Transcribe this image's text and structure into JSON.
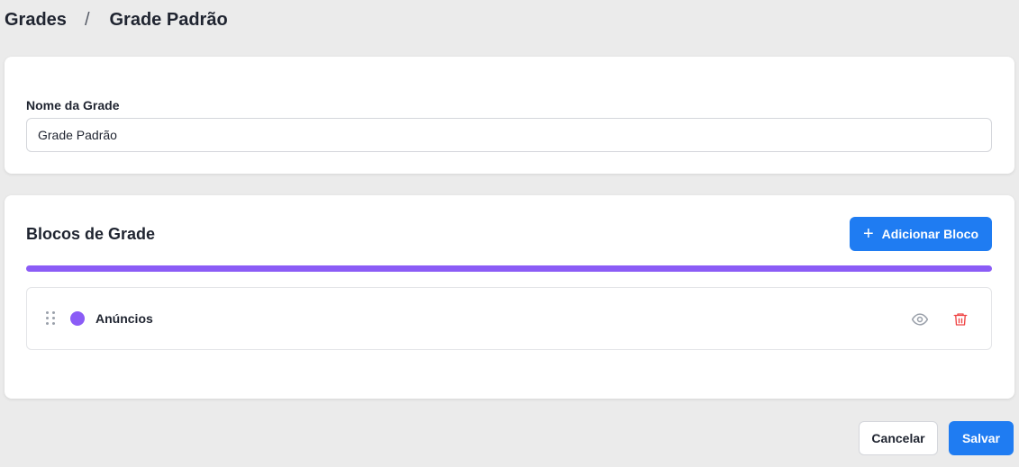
{
  "breadcrumb": {
    "parent": "Grades",
    "separator": "/",
    "current": "Grade Padrão"
  },
  "name_card": {
    "label": "Nome da Grade",
    "input_value": "Grade Padrão"
  },
  "blocks_card": {
    "title": "Blocos de Grade",
    "add_button_label": "Adicionar Bloco",
    "timeline_color": "#8b5cf6",
    "items": [
      {
        "label": "Anúncios",
        "color": "#8b5cf6"
      }
    ]
  },
  "footer": {
    "cancel_label": "Cancelar",
    "save_label": "Salvar"
  },
  "colors": {
    "primary": "#1f7cf2",
    "danger": "#ef4444",
    "background": "#ebebeb"
  },
  "icons": [
    "plus-icon",
    "drag-handle-icon",
    "eye-icon",
    "trash-icon"
  ]
}
